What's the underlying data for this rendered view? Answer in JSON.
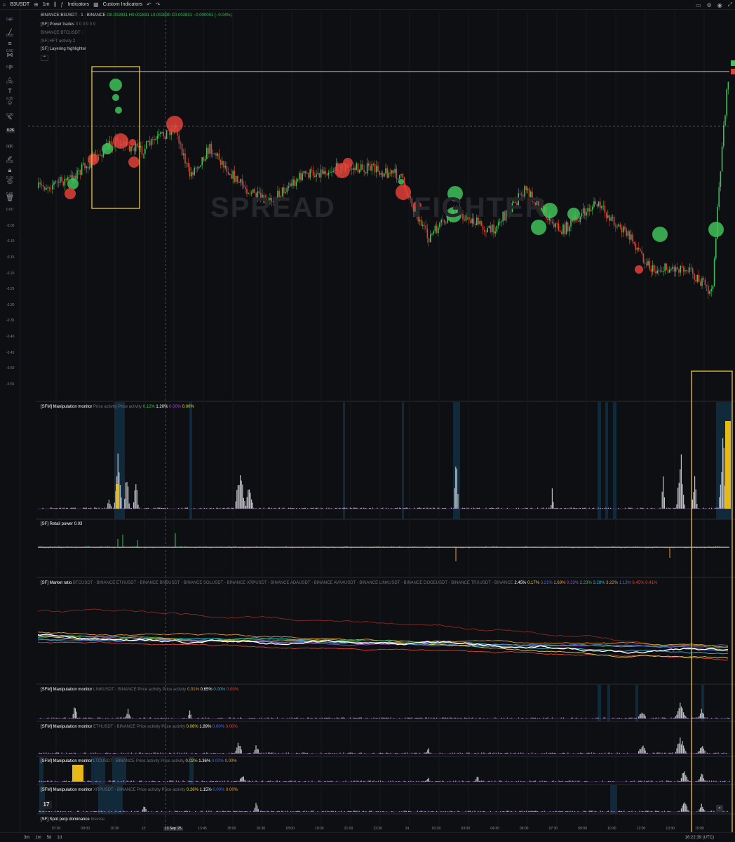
{
  "topbar": {
    "symbol": "B3USDT",
    "interval": "1m",
    "indicators_label": "Indicators",
    "custom_indicators_label": "Custom Indicators",
    "undo_icon": "undo-icon",
    "search_icon": "search-icon"
  },
  "main_chart": {
    "title": "BINANCE:B3USDT · 1 · BINANCE",
    "ohlc": {
      "o": "O0.002831",
      "h": "H0.002831",
      "l": "L0.002830",
      "c": "C0.002831",
      "change": "−0.000001 (−0.04%)"
    },
    "indicators": [
      {
        "label": "[SF] Power trades",
        "value": "3  0 0 0 0 0"
      },
      {
        "label": "BINANCE:BTCUSDT",
        "value": ""
      },
      {
        "label": "[SF] HFT activity",
        "value": "2"
      },
      {
        "label": "[SF] Layering highlighter",
        "value": ""
      }
    ],
    "y_ticks": [
      "0.60",
      "0.55",
      "0.50",
      "0.45",
      "0.40",
      "0.35",
      "0.30",
      "0.26",
      "0.20",
      "0.15",
      "0.10",
      "0.05",
      "0.00",
      "-0.05",
      "-0.10",
      "-0.15",
      "-0.20",
      "-0.25",
      "-0.30",
      "-0.35",
      "-0.40",
      "-0.45",
      "-0.50",
      "-0.55"
    ],
    "price_tag": "0.26",
    "watermark_left": "SPREAD",
    "watermark_right": "FIGHTER"
  },
  "panels": {
    "manip_main": {
      "title": "[SFM] Manipulation monitor",
      "sub": "Price activity Price activity",
      "v1": "0.12%",
      "v2": "1.20%",
      "v3": "0.00%",
      "v4": "0.00%"
    },
    "retail": {
      "title": "[SF] Retail power",
      "value": "0.03"
    },
    "market_ratio": {
      "title": "[SF] Market ratio",
      "sub": "BTCUSDT - BINANCE ETHUSDT - BINANCE BNBUSDT - BINANCE SOLUSDT - BINANCE XRPUSDT - BINANCE ADAUSDT - BINANCE AVAXUSDT - BINANCE LINKUSDT - BINANCE DOGEUSDT - BINANCE TRXUSDT - BINANCE",
      "values": [
        "2.45%",
        "0.17%",
        "3.21%",
        "1.69%",
        "0.33%",
        "2.23%",
        "3.28%",
        "3.22%",
        "1.13%",
        "6.45%",
        "0.41%"
      ]
    },
    "manip_link": {
      "title": "[SFM] Manipulation monitor",
      "sub": "LINKUSDT - BINANCE Price activity Price activity",
      "v1": "0.01%",
      "v2": "0.65%",
      "v3": "0.00%",
      "v4": "0.00%"
    },
    "manip_eth": {
      "title": "[SFM] Manipulation monitor",
      "sub": "ETHUSDT - BINANCE Price activity Price activity",
      "v1": "0.06%",
      "v2": "1.89%",
      "v3": "0.00%",
      "v4": "0.00%"
    },
    "manip_ltc": {
      "title": "[SFM] Manipulation monitor",
      "sub": "LTCUSDT - BINANCE Price activity Price activity",
      "v1": "0.02%",
      "v2": "1.36%",
      "v3": "0.00%",
      "v4": "0.00%"
    },
    "manip_xrp": {
      "title": "[SFM] Manipulation monitor",
      "sub": "XRPUSDT - BINANCE Price activity Price activity",
      "v1": "0.26%",
      "v2": "1.15%",
      "v3": "0.00%",
      "v4": "0.00%"
    },
    "spot_perp": {
      "title": "[SF] Spot perp dominance",
      "sub": "Inverse"
    }
  },
  "x_axis": [
    "07:30",
    "09:00",
    "10:30",
    "12:",
    "13 Sep '25",
    "13:45",
    "15:00",
    "16:30",
    "18:00",
    "19:30",
    "21:00",
    "22:30",
    "14",
    "01:30",
    "03:00",
    "04:30",
    "06:00",
    "07:30",
    "09:00",
    "10:30",
    "12:00",
    "13:30",
    "15:00"
  ],
  "bottombar": {
    "ranges": [
      "3m",
      "1m",
      "5d",
      "1d"
    ],
    "time": "16:22:39 (UTC)"
  },
  "colors": {
    "bg": "#0e0f12",
    "up": "#3fbf5b",
    "down": "#e0403a",
    "highlight": "#e8c547",
    "cyan_band": "#1b3a4e"
  }
}
